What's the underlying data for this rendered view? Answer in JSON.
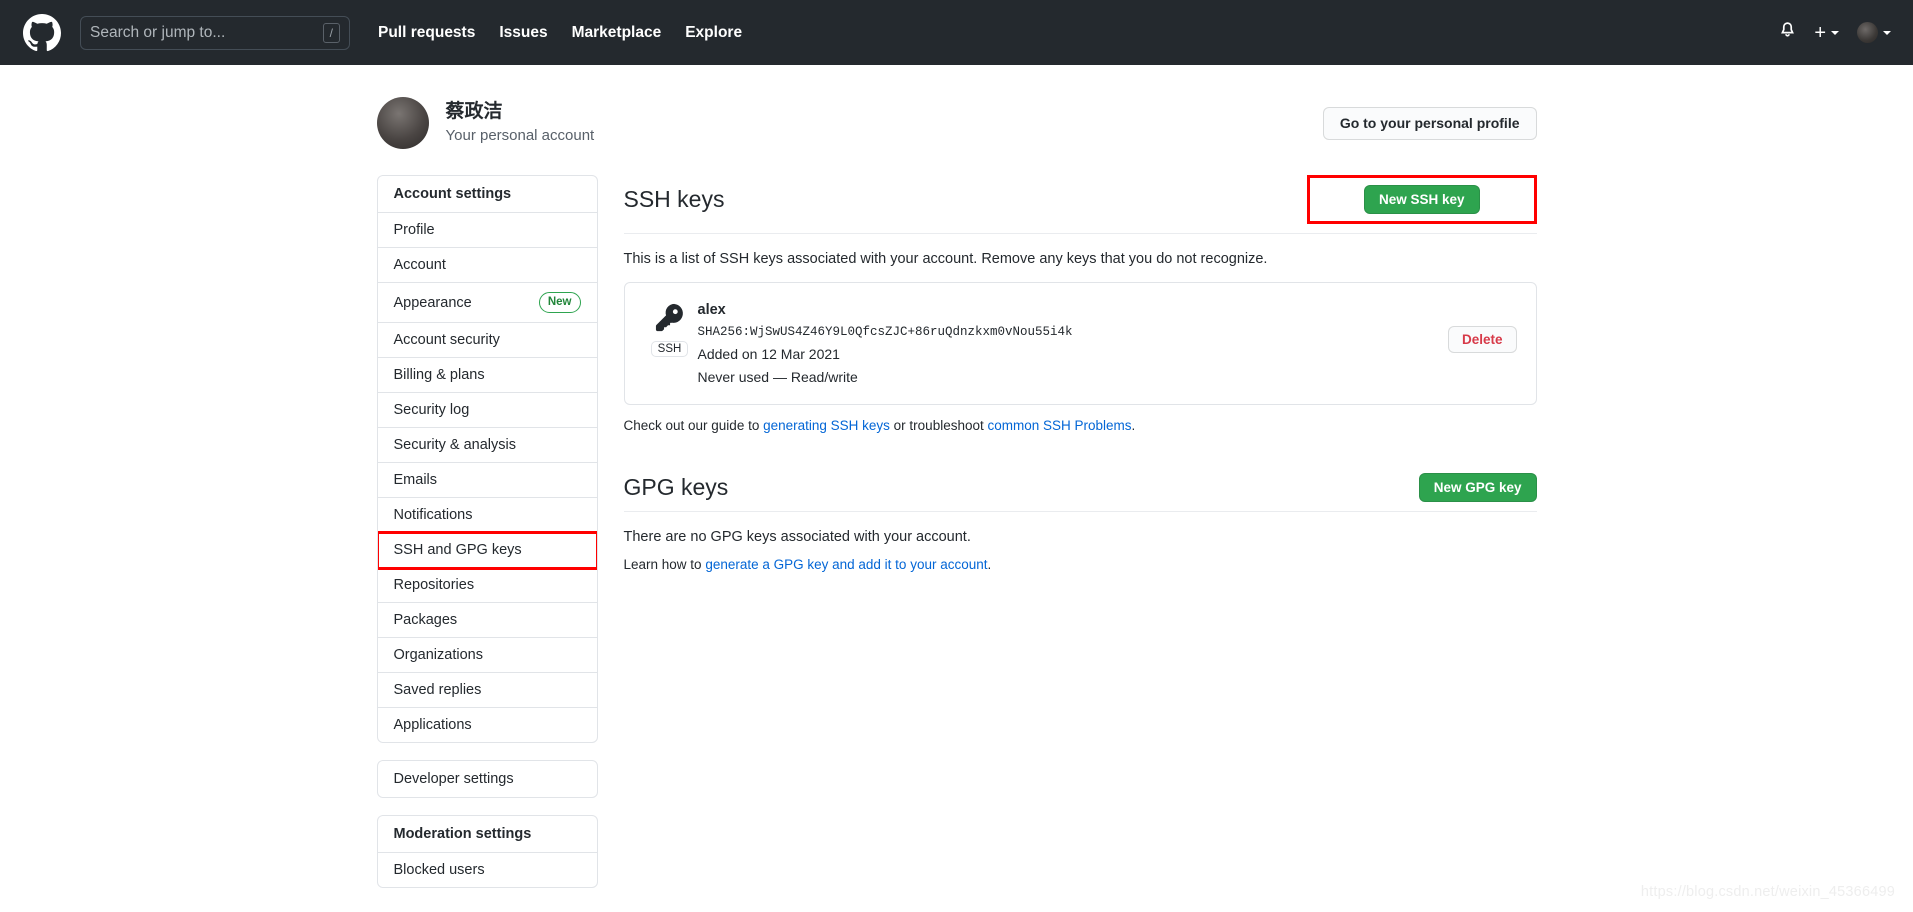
{
  "header": {
    "logo_icon": "github-mark-icon",
    "search": {
      "placeholder": "Search or jump to...",
      "value": "",
      "shortcut": "/"
    },
    "nav": [
      {
        "label": "Pull requests"
      },
      {
        "label": "Issues"
      },
      {
        "label": "Marketplace"
      },
      {
        "label": "Explore"
      }
    ],
    "notifications_icon": "bell-icon",
    "create_new_icon": "plus-icon",
    "avatar_icon": "avatar",
    "background_color": "#24292e"
  },
  "profile": {
    "name": "蔡政洁",
    "subtitle": "Your personal account",
    "profile_button": "Go to your personal profile"
  },
  "sidebar": {
    "account_settings_header": "Account settings",
    "items": [
      {
        "label": "Profile"
      },
      {
        "label": "Account"
      },
      {
        "label": "Appearance",
        "badge": "New"
      },
      {
        "label": "Account security"
      },
      {
        "label": "Billing & plans"
      },
      {
        "label": "Security log"
      },
      {
        "label": "Security & analysis"
      },
      {
        "label": "Emails"
      },
      {
        "label": "Notifications"
      },
      {
        "label": "SSH and GPG keys",
        "highlighted": true
      },
      {
        "label": "Repositories"
      },
      {
        "label": "Packages"
      },
      {
        "label": "Organizations"
      },
      {
        "label": "Saved replies"
      },
      {
        "label": "Applications"
      }
    ],
    "developer_settings": "Developer settings",
    "moderation_settings_header": "Moderation settings",
    "moderation_items": [
      {
        "label": "Blocked users"
      }
    ]
  },
  "ssh_section": {
    "title": "SSH keys",
    "new_key_button": "New SSH key",
    "description": "This is a list of SSH keys associated with your account. Remove any keys that you do not recognize.",
    "keys": [
      {
        "name": "alex",
        "fingerprint": "SHA256:WjSwUS4Z46Y9L0QfcsZJC+86ruQdnzkxm0vNou55i4k",
        "added": "Added on 12 Mar 2021",
        "usage": "Never used — Read/write",
        "type_tag": "SSH",
        "delete_button": "Delete"
      }
    ],
    "guide_prefix": "Check out our guide to ",
    "guide_link_1": "generating SSH keys",
    "guide_middle": " or troubleshoot ",
    "guide_link_2": "common SSH Problems",
    "guide_suffix": "."
  },
  "gpg_section": {
    "title": "GPG keys",
    "new_key_button": "New GPG key",
    "empty_message": "There are no GPG keys associated with your account.",
    "learn_prefix": "Learn how to ",
    "learn_link": "generate a GPG key and add it to your account",
    "learn_suffix": "."
  },
  "watermark": "https://blog.csdn.net/weixin_45366499",
  "colors": {
    "header_bg": "#24292e",
    "green_button": "#2ea44f",
    "link_blue": "#0366d6",
    "delete_red": "#d73a49",
    "highlight_red": "#ff0000",
    "border": "#e1e4e8"
  }
}
